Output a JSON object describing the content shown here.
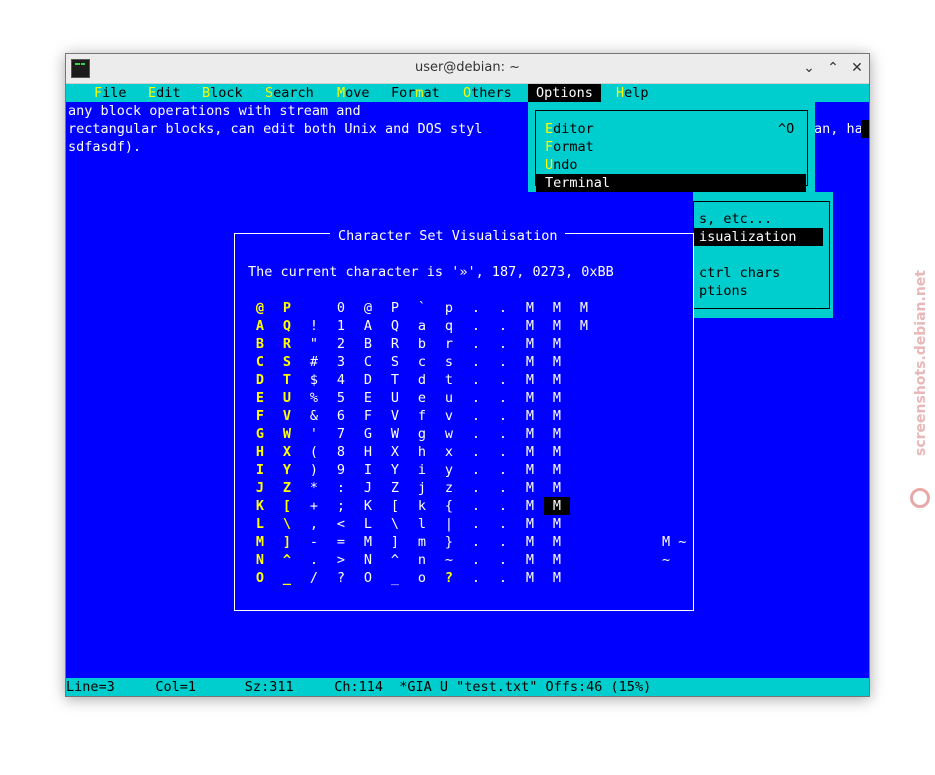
{
  "window": {
    "title": "user@debian: ~"
  },
  "menu": [
    {
      "hk": "F",
      "rest": "ile"
    },
    {
      "hk": "E",
      "rest": "dit"
    },
    {
      "hk": "B",
      "rest": "lock"
    },
    {
      "hk": "S",
      "rest": "earch"
    },
    {
      "hk": "M",
      "rest": "ove"
    },
    {
      "pre": "For",
      "hk": "m",
      "rest": "at"
    },
    {
      "hk": "O",
      "rest": "thers"
    },
    {
      "label": "Options"
    },
    {
      "hk": "H",
      "rest": "elp"
    }
  ],
  "editor_lines": [
    "any block operations with stream and",
    "rectangular blocks, can edit both Unix and DOS styl",
    "sdfasdf)."
  ],
  "editor_right_fragment": "an, ha",
  "options_menu": {
    "items": [
      {
        "hk": "E",
        "rest": "ditor",
        "shortcut": "^O"
      },
      {
        "hk": "F",
        "rest": "ormat"
      },
      {
        "hk": "U",
        "rest": "ndo"
      },
      {
        "label": "Terminal"
      }
    ]
  },
  "terminal_submenu": {
    "items": [
      "s, etc...",
      "isualization",
      "",
      "ctrl chars",
      "ptions"
    ]
  },
  "charset_dialog": {
    "title": "Character Set Visualisation",
    "current": "The current character is '»', 187, 0273, 0xBB",
    "rows": [
      [
        "@",
        "P",
        "",
        "0",
        "@",
        "P",
        "`",
        "p",
        ".",
        ".",
        "M",
        "M",
        "M"
      ],
      [
        "A",
        "Q",
        "!",
        "1",
        "A",
        "Q",
        "a",
        "q",
        ".",
        ".",
        "M",
        "M",
        "M"
      ],
      [
        "B",
        "R",
        "\"",
        "2",
        "B",
        "R",
        "b",
        "r",
        ".",
        ".",
        "M",
        "M",
        ""
      ],
      [
        "C",
        "S",
        "#",
        "3",
        "C",
        "S",
        "c",
        "s",
        ".",
        ".",
        "M",
        "M",
        ""
      ],
      [
        "D",
        "T",
        "$",
        "4",
        "D",
        "T",
        "d",
        "t",
        ".",
        ".",
        "M",
        "M",
        ""
      ],
      [
        "E",
        "U",
        "%",
        "5",
        "E",
        "U",
        "e",
        "u",
        ".",
        ".",
        "M",
        "M",
        ""
      ],
      [
        "F",
        "V",
        "&",
        "6",
        "F",
        "V",
        "f",
        "v",
        ".",
        ".",
        "M",
        "M",
        ""
      ],
      [
        "G",
        "W",
        "'",
        "7",
        "G",
        "W",
        "g",
        "w",
        ".",
        ".",
        "M",
        "M",
        ""
      ],
      [
        "H",
        "X",
        "(",
        "8",
        "H",
        "X",
        "h",
        "x",
        ".",
        ".",
        "M",
        "M",
        ""
      ],
      [
        "I",
        "Y",
        ")",
        "9",
        "I",
        "Y",
        "i",
        "y",
        ".",
        ".",
        "M",
        "M",
        ""
      ],
      [
        "J",
        "Z",
        "*",
        ":",
        "J",
        "Z",
        "j",
        "z",
        ".",
        ".",
        "M",
        "M",
        ""
      ],
      [
        "K",
        "[",
        "+",
        ";",
        "K",
        "[",
        "k",
        "{",
        ".",
        ".",
        "M",
        "M",
        ""
      ],
      [
        "L",
        "\\",
        ",",
        "<",
        "L",
        "\\",
        "l",
        "|",
        ".",
        ".",
        "M",
        "M",
        ""
      ],
      [
        "M",
        "]",
        "-",
        "=",
        "M",
        "]",
        "m",
        "}",
        ".",
        ".",
        "M",
        "M",
        ""
      ],
      [
        "N",
        "^",
        ".",
        ">",
        "N",
        "^",
        "n",
        "~",
        ".",
        ".",
        "M",
        "M",
        ""
      ],
      [
        "O",
        "_",
        "/",
        "?",
        "O",
        "_",
        "o",
        "?",
        ".",
        ".",
        "M",
        "M",
        ""
      ]
    ],
    "extra_right": [
      {
        "row": 13,
        "text": "M ~"
      },
      {
        "row": 14,
        "text": "~"
      }
    ],
    "highlight": {
      "row": 11,
      "col": 11
    }
  },
  "status_bar": "Line=3     Col=1      Sz:311     Ch:114  *GIA U \"test.txt\" Offs:46 (15%)",
  "watermark": "screenshots.debian.net"
}
